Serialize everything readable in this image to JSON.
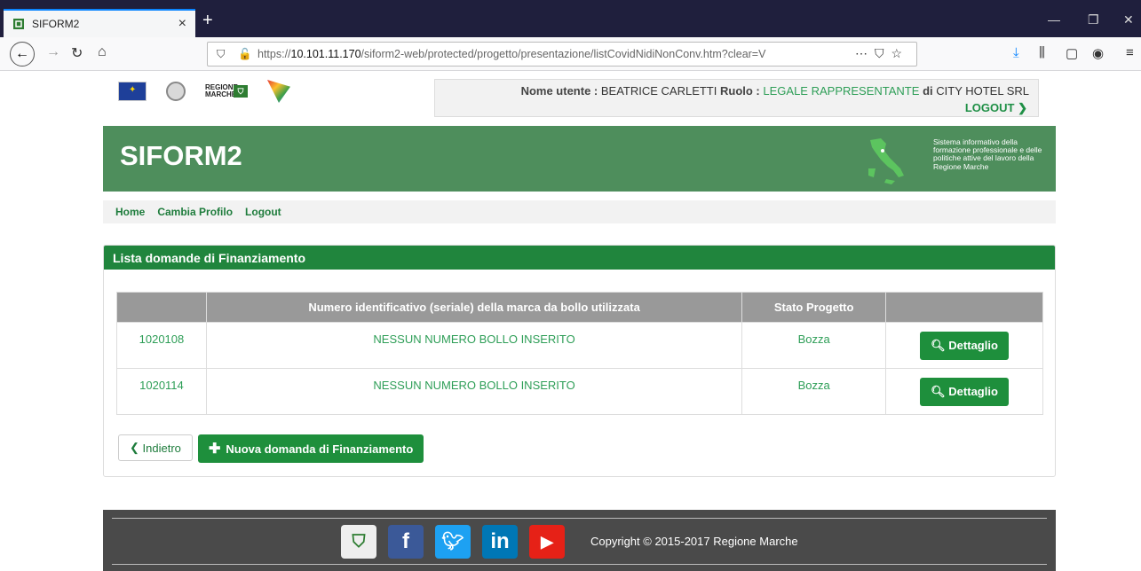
{
  "browser": {
    "tab_title": "SIFORM2",
    "url_prefix": "https://",
    "url_host": "10.101.11.170",
    "url_path": "/siform2-web/protected/progetto/presentazione/listCovidNidiNonConv.htm?clear=V"
  },
  "header": {
    "logos": [
      "eu-flag-logo",
      "italian-republic-emblem",
      "regione-marche-logo",
      "fse-logo"
    ],
    "regione_logo_text": "REGIONE MARCHE",
    "user_label": "Nome utente :",
    "user_name": "BEATRICE CARLETTI",
    "role_label": "Ruolo :",
    "role_value": "LEGALE RAPPRESENTANTE",
    "company_prefix": "di",
    "company_name": "CITY HOTEL SRL",
    "logout": "LOGOUT"
  },
  "banner": {
    "title": "SIFORM2",
    "description": "Sistema informativo della formazione professionale e delle politiche attive del lavoro della Regione Marche",
    "color": "#4e8e5c"
  },
  "breadcrumb": {
    "items": [
      "Home",
      "Cambia Profilo",
      "Logout"
    ]
  },
  "panel": {
    "title": "Lista domande di Finanziamento",
    "columns": [
      "",
      "Numero identificativo (seriale) della marca da bollo utilizzata",
      "Stato Progetto",
      ""
    ],
    "rows": [
      {
        "id": "1020108",
        "bollo": "NESSUN NUMERO BOLLO INSERITO",
        "stato": "Bozza",
        "action": "Dettaglio"
      },
      {
        "id": "1020114",
        "bollo": "NESSUN NUMERO BOLLO INSERITO",
        "stato": "Bozza",
        "action": "Dettaglio"
      }
    ],
    "back_button": "Indietro",
    "new_button": "Nuova domanda di Finanziamento",
    "accent": "#1e8f3c"
  },
  "footer": {
    "social": [
      "regione-marche-icon",
      "facebook-icon",
      "twitter-icon",
      "linkedin-icon",
      "youtube-icon"
    ],
    "copyright": "Copyright © 2015-2017 Regione Marche"
  }
}
